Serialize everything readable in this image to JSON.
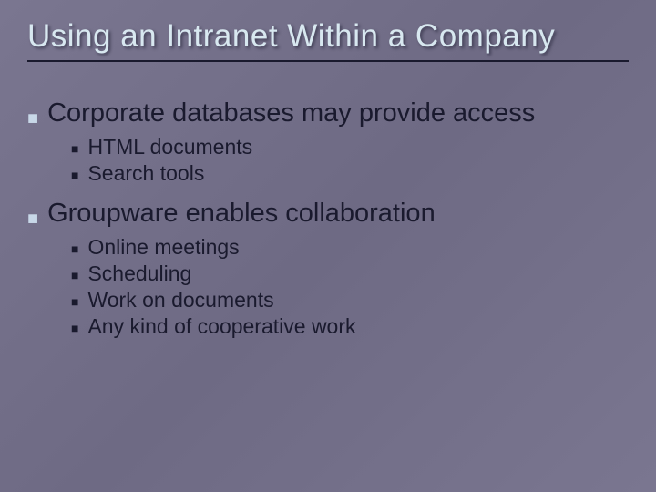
{
  "slide": {
    "title": "Using an Intranet Within a Company",
    "bullets": [
      {
        "text": "Corporate databases may provide access",
        "children": [
          {
            "text": "HTML documents"
          },
          {
            "text": "Search tools"
          }
        ]
      },
      {
        "text": "Groupware enables collaboration",
        "children": [
          {
            "text": "Online meetings"
          },
          {
            "text": "Scheduling"
          },
          {
            "text": "Work on documents"
          },
          {
            "text": "Any kind of cooperative work"
          }
        ]
      }
    ]
  }
}
